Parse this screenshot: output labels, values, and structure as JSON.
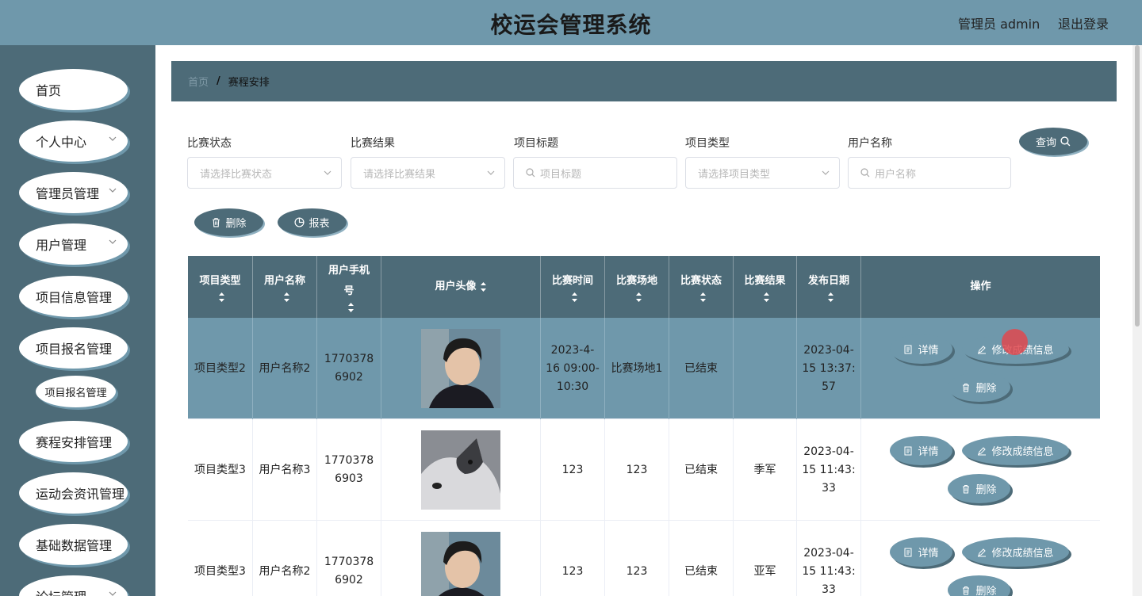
{
  "header": {
    "title": "校运会管理系统",
    "user": "管理员 admin",
    "logout": "退出登录"
  },
  "sidebar": {
    "items": [
      {
        "label": "首页"
      },
      {
        "label": "个人中心"
      },
      {
        "label": "管理员管理"
      },
      {
        "label": "用户管理"
      },
      {
        "label": "项目信息管理"
      },
      {
        "label": "项目报名管理"
      },
      {
        "label": "赛程安排管理"
      },
      {
        "label": "运动会资讯管理"
      },
      {
        "label": "基础数据管理"
      },
      {
        "label": "论坛管理"
      }
    ],
    "sub_item": "项目报名管理"
  },
  "breadcrumb": {
    "home": "首页",
    "sep": "/",
    "current": "赛程安排"
  },
  "filters": {
    "status": {
      "label": "比赛状态",
      "placeholder": "请选择比赛状态"
    },
    "result": {
      "label": "比赛结果",
      "placeholder": "请选择比赛结果"
    },
    "title": {
      "label": "项目标题",
      "placeholder": "项目标题"
    },
    "type": {
      "label": "项目类型",
      "placeholder": "请选择项目类型"
    },
    "username": {
      "label": "用户名称",
      "placeholder": "用户名称"
    }
  },
  "buttons": {
    "query": "查询",
    "delete": "删除",
    "report": "报表"
  },
  "table": {
    "headers": [
      "项目类型",
      "用户名称",
      "用户手机号",
      "用户头像",
      "比赛时间",
      "比赛场地",
      "比赛状态",
      "比赛结果",
      "发布日期",
      "操作"
    ],
    "rows": [
      {
        "type": "项目类型2",
        "user": "用户名称2",
        "phone": "17703786902",
        "time": "2023-4-16 09:00-10:30",
        "venue": "比赛场地1",
        "status": "已结束",
        "result": "",
        "date": "2023-04-15 13:37:57"
      },
      {
        "type": "项目类型3",
        "user": "用户名称3",
        "phone": "17703786903",
        "time": "123",
        "venue": "123",
        "status": "已结束",
        "result": "季军",
        "date": "2023-04-15 11:43:33"
      },
      {
        "type": "项目类型3",
        "user": "用户名称2",
        "phone": "17703786902",
        "time": "123",
        "venue": "123",
        "status": "已结束",
        "result": "亚军",
        "date": "2023-04-15 11:43:33"
      }
    ],
    "actions": {
      "detail": "详情",
      "edit": "修改成绩信息",
      "delete": "删除"
    }
  },
  "colors": {
    "header": "#6f98ab",
    "sidebar": "#4d6b78",
    "accent": "#6f98ab"
  }
}
